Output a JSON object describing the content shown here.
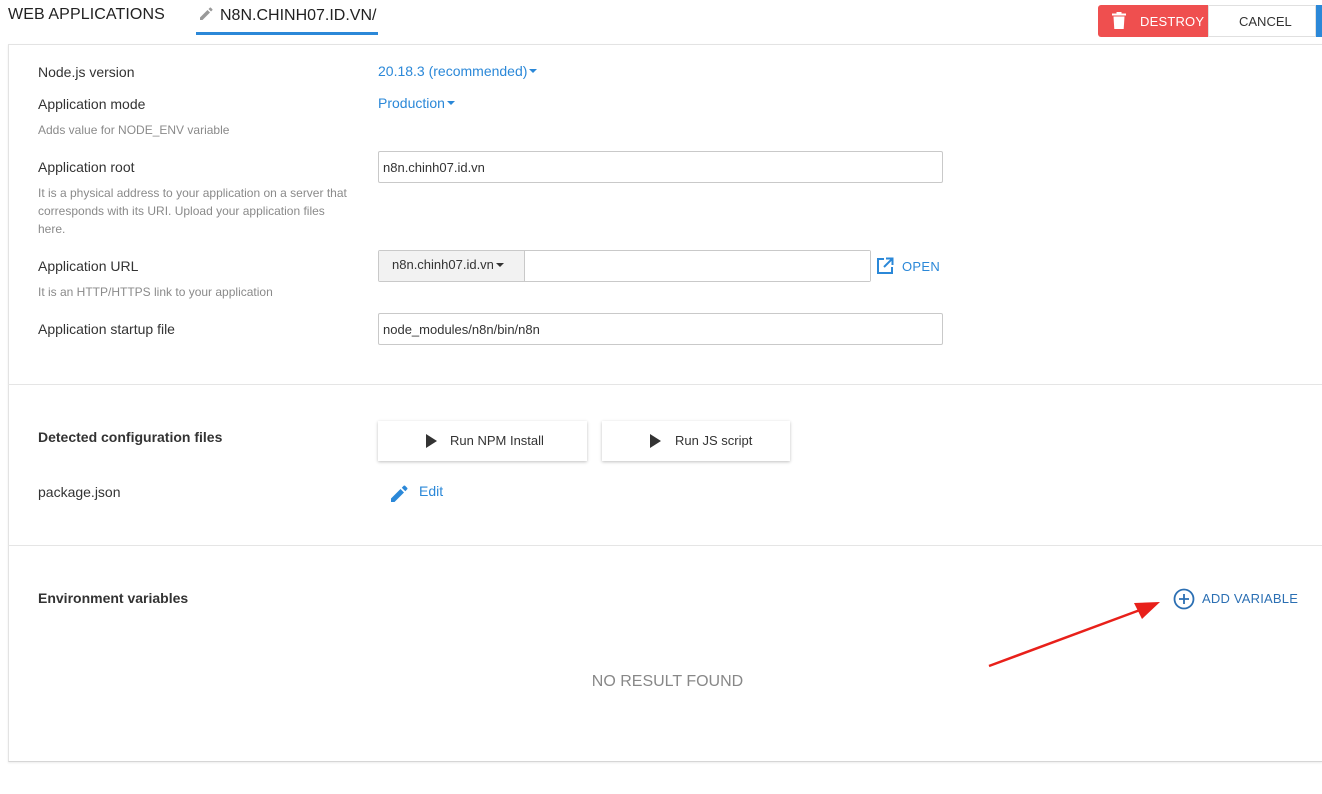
{
  "header": {
    "section_title": "WEB APPLICATIONS",
    "app_tab_label": "N8N.CHINH07.ID.VN/",
    "destroy_label": "DESTROY",
    "cancel_label": "CANCEL"
  },
  "form": {
    "node_version": {
      "label": "Node.js version",
      "value": "20.18.3 (recommended)"
    },
    "app_mode": {
      "label": "Application mode",
      "value": "Production",
      "hint": "Adds value for NODE_ENV variable"
    },
    "app_root": {
      "label": "Application root",
      "value": "n8n.chinh07.id.vn",
      "hint": "It is a physical address to your application on a server that corresponds with its URI. Upload your application files here."
    },
    "app_url": {
      "label": "Application URL",
      "domain": "n8n.chinh07.id.vn",
      "path_value": "",
      "hint": "It is an HTTP/HTTPS link to your application",
      "open_label": "OPEN"
    },
    "startup_file": {
      "label": "Application startup file",
      "value": "node_modules/n8n/bin/n8n"
    }
  },
  "config_files": {
    "title": "Detected configuration files",
    "run_npm_label": "Run NPM Install",
    "run_js_label": "Run JS script",
    "file_name": "package.json",
    "edit_label": "Edit"
  },
  "env_vars": {
    "title": "Environment variables",
    "add_label": "ADD VARIABLE",
    "empty_text": "NO RESULT FOUND"
  },
  "colors": {
    "accent": "#2b88d8",
    "destroy": "#ef4f4f",
    "annotation_arrow": "#e8201a"
  }
}
